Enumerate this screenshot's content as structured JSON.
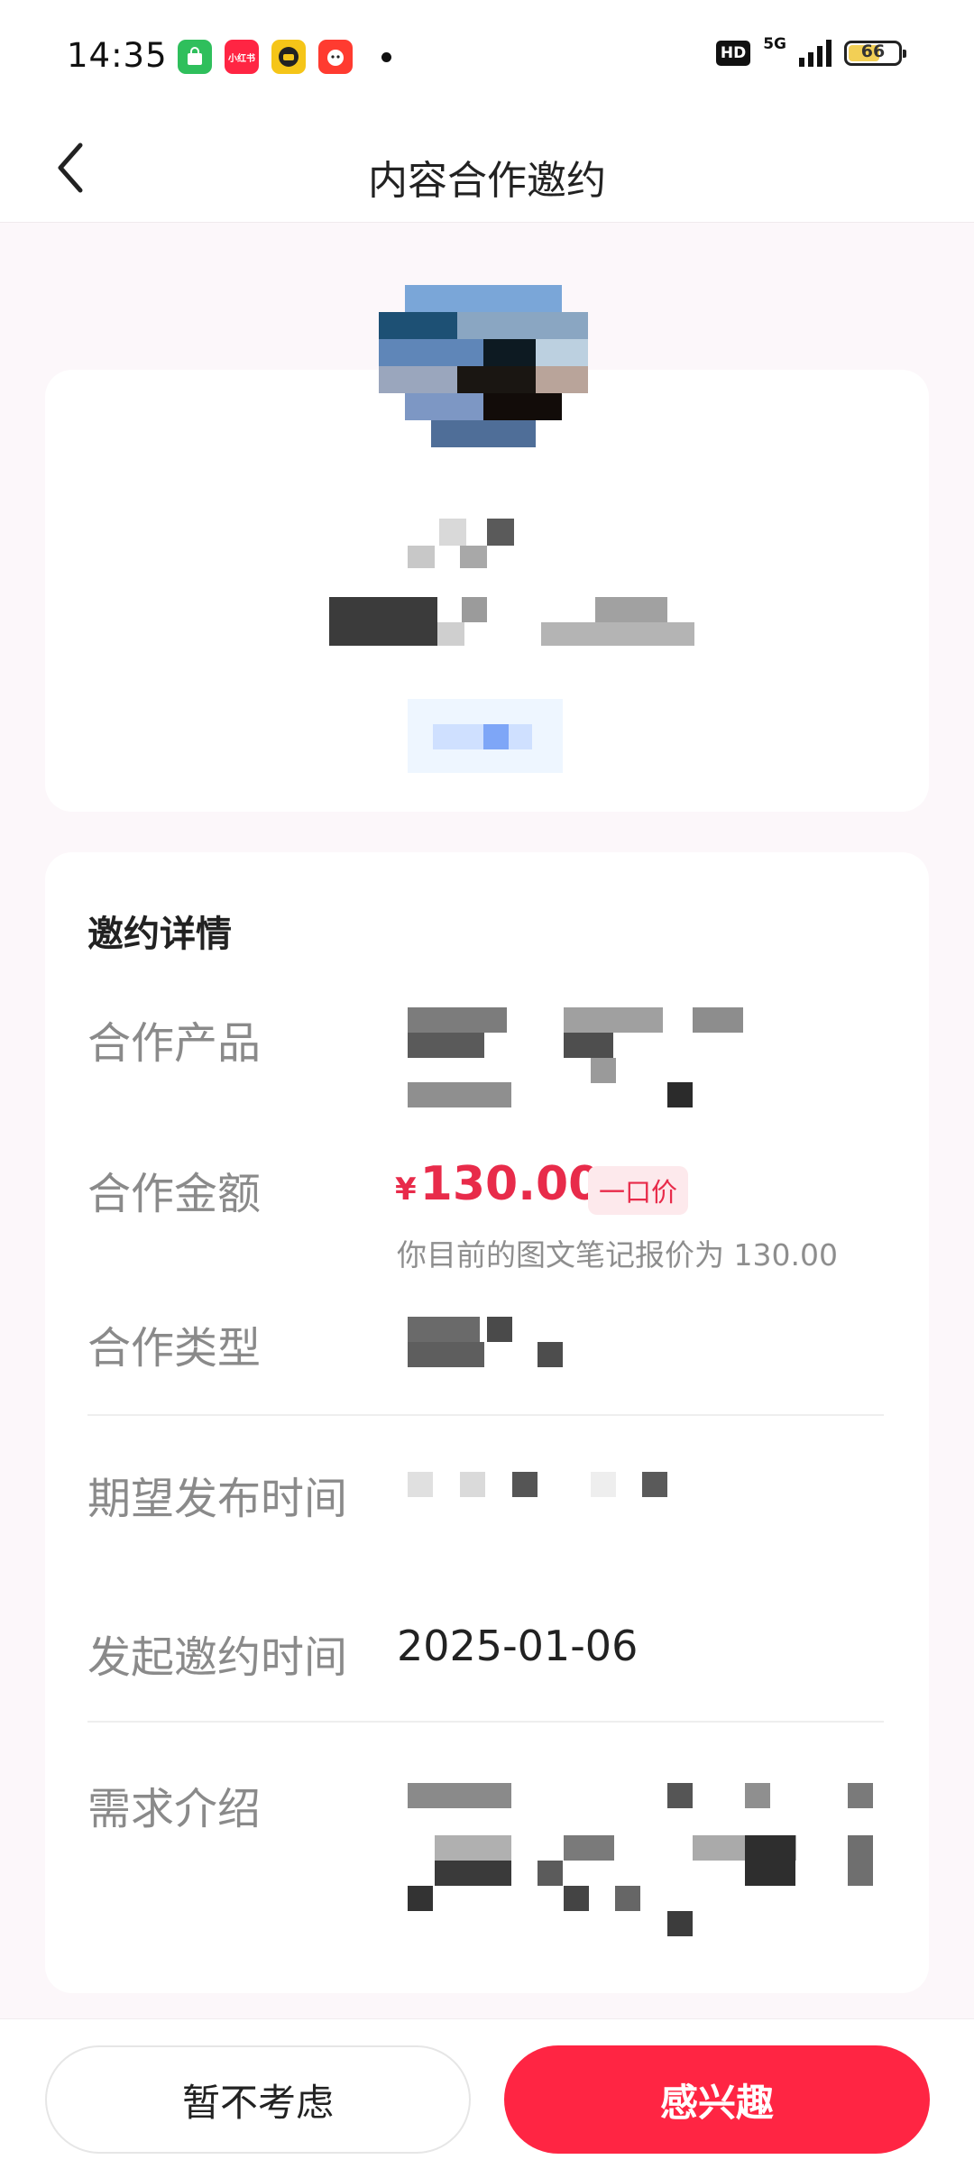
{
  "status_bar": {
    "time": "14:35",
    "network": "5G",
    "hd_label": "HD",
    "battery_level": "66",
    "battery_fraction": 0.66,
    "app_icons": [
      "shopping-bag-icon",
      "xiaohongshu-icon",
      "taxi-app-icon",
      "dog-app-icon"
    ],
    "xiaohongshu_label": "小红书"
  },
  "nav": {
    "title": "内容合作邀约",
    "back_icon": "chevron-left-icon"
  },
  "details": {
    "section_title": "邀约详情",
    "rows": {
      "product_label": "合作产品",
      "amount_label": "合作金额",
      "type_label": "合作类型",
      "expected_time_label": "期望发布时间",
      "initiated_time_label": "发起邀约时间",
      "initiated_time_value": "2025-01-06",
      "requirement_label": "需求介绍"
    },
    "price": {
      "currency": "¥",
      "value": "130.00",
      "tag": "一口价",
      "note": "你目前的图文笔记报价为 130.00"
    }
  },
  "actions": {
    "decline_label": "暂不考虑",
    "interest_label": "感兴趣"
  },
  "colors": {
    "accent": "#ff2543",
    "price": "#e82b4a",
    "page_bg": "#fcf7fa"
  }
}
